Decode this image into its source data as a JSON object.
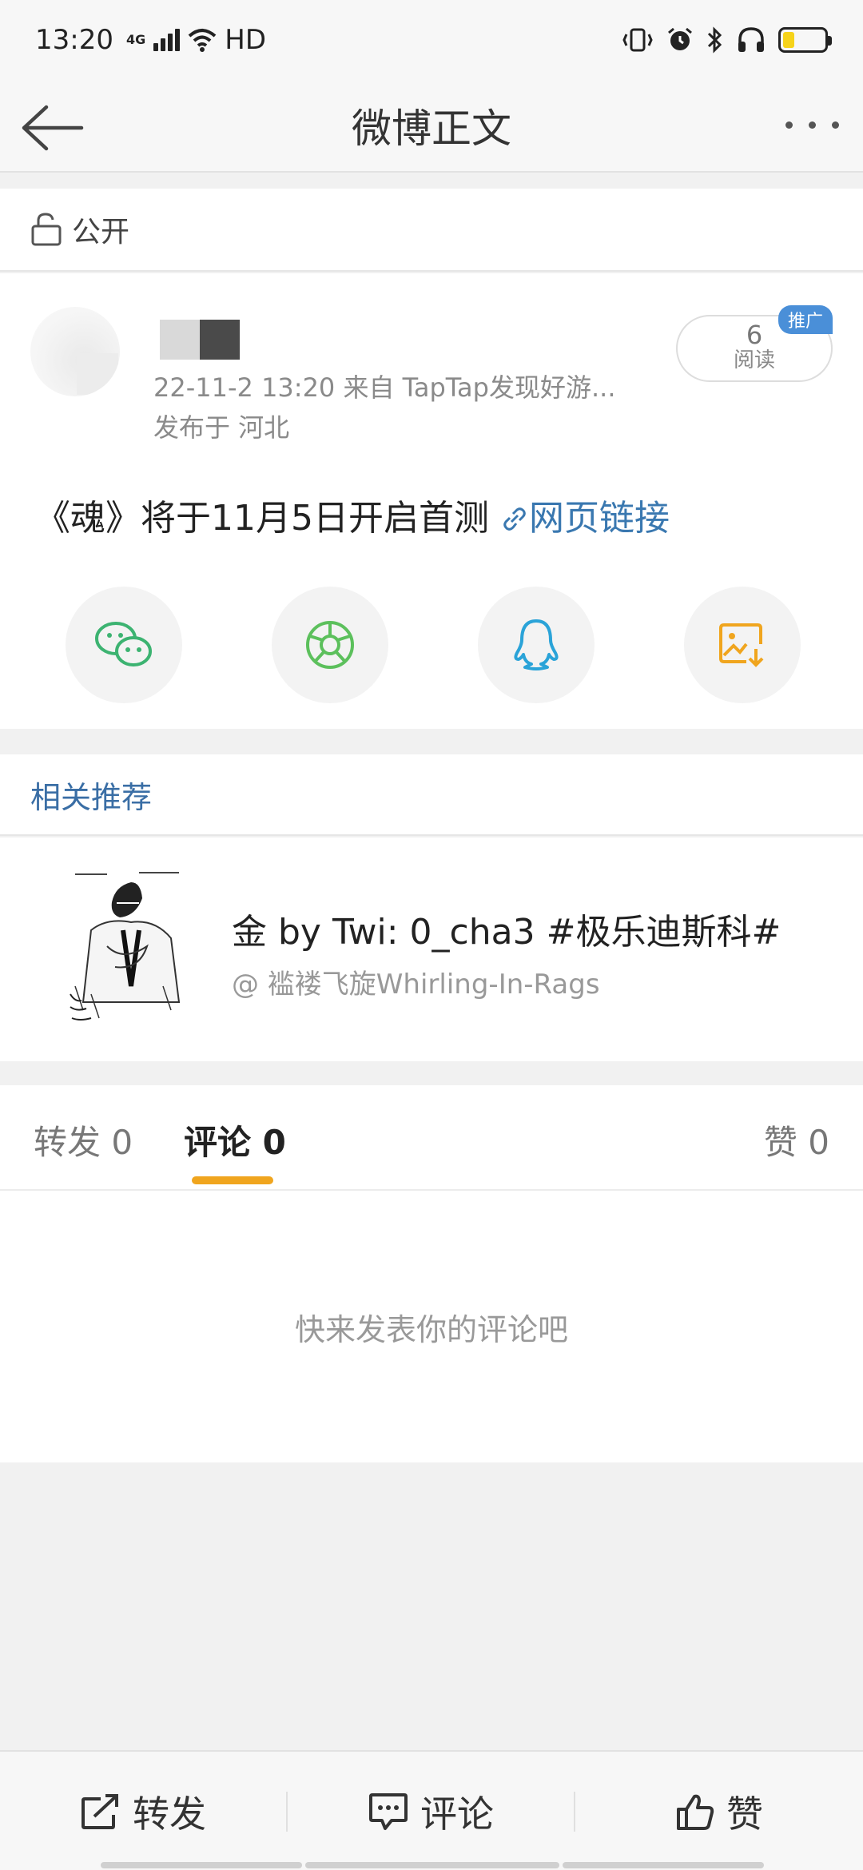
{
  "status_bar": {
    "time": "13:20",
    "network": "4G",
    "hd": "HD",
    "icons": [
      "signal-icon",
      "wifi-icon",
      "vibrate-icon",
      "alarm-icon",
      "bluetooth-icon",
      "headphones-icon",
      "battery-icon"
    ],
    "battery_color": "#f6d31a"
  },
  "nav": {
    "title": "微博正文",
    "back_icon": "back-arrow-icon",
    "more_icon": "more-icon"
  },
  "visibility": {
    "label": "公开",
    "icon": "unlock-icon"
  },
  "post": {
    "meta": "22-11-2 13:20  来自 TapTap发现好游...",
    "location": "发布于 河北",
    "read_count": "6",
    "read_label": "阅读",
    "promo_tag": "推广",
    "text": "《魂》将于11月5日开启首测 ",
    "link_text": "网页链接",
    "share": [
      {
        "icon": "wechat-icon",
        "color": "#3cb371"
      },
      {
        "icon": "moments-icon",
        "color": "#5cc05c"
      },
      {
        "icon": "qq-icon",
        "color": "#2aa3d8"
      },
      {
        "icon": "save-image-icon",
        "color": "#f0a51e"
      }
    ]
  },
  "related": {
    "title": "相关推荐",
    "item_title": "金 by Twi: 0_cha3 #极乐迪斯科#",
    "item_author": "@ 褴褛飞旋Whirling-In-Rags"
  },
  "tabs": {
    "repost": "转发 0",
    "comment": "评论 0",
    "like": "赞 0",
    "active": "comment",
    "accent": "#f0a51e"
  },
  "comments": {
    "empty": "快来发表你的评论吧"
  },
  "bottom_bar": {
    "repost": "转发",
    "comment": "评论",
    "like": "赞"
  }
}
